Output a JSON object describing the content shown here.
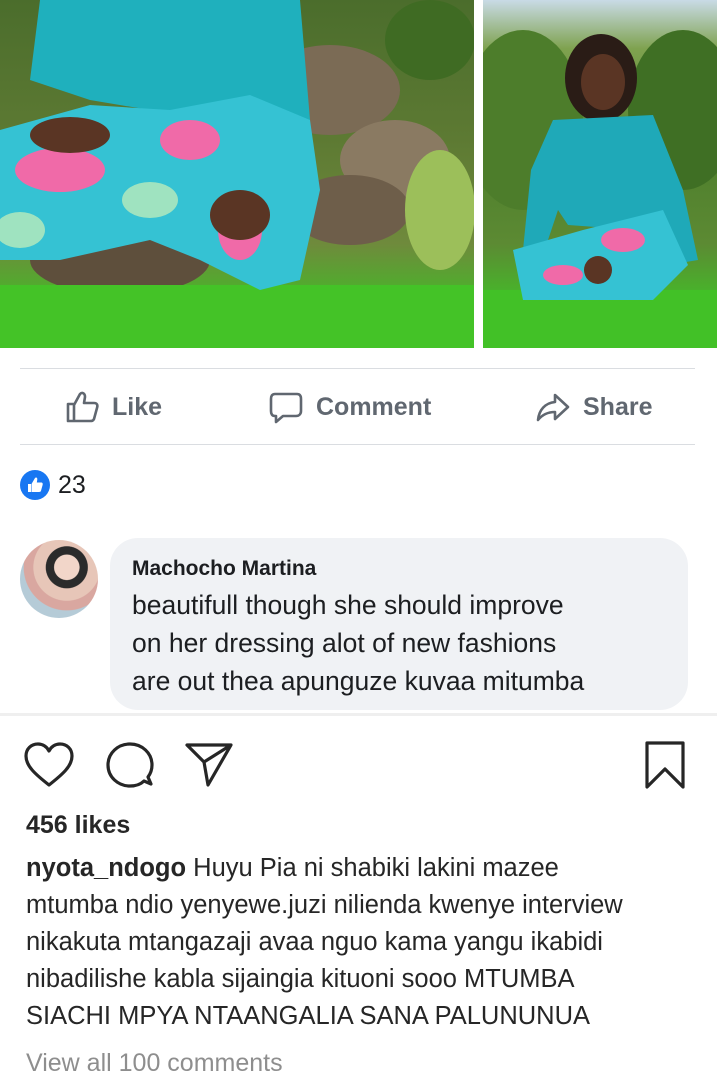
{
  "post_photos": {
    "items": [
      {
        "description_icon": "photo-image"
      },
      {
        "description_icon": "photo-image"
      }
    ]
  },
  "facebook_actions": {
    "like_label": "Like",
    "comment_label": "Comment",
    "share_label": "Share"
  },
  "reactions": {
    "count": "23",
    "accent_color": "#1877f2"
  },
  "comment": {
    "author": "Machocho Martina",
    "lines": [
      "beautifull though she should improve",
      "on her dressing alot of new fashions",
      "are out thea apunguze kuvaa mitumba"
    ]
  },
  "instagram": {
    "likes": "456 likes",
    "caption_user": "nyota_ndogo",
    "caption_lines": [
      "Huyu Pia ni shabiki lakini mazee",
      "mtumba ndio yenyewe.juzi nilienda kwenye interview",
      "nikakuta mtangazaji avaa nguo kama yangu ikabidi",
      "nibadilishe kabla sijaingia kituoni sooo MTUMBA",
      "SIACHI MPYA NTAANGALIA SANA PALUNUNUA"
    ],
    "view_all_comments": "View all 100 comments"
  }
}
